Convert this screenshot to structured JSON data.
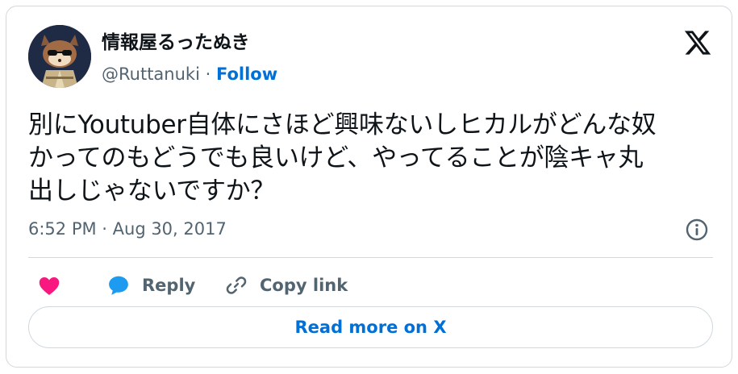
{
  "author": {
    "name": "情報屋るったぬき",
    "handle": "@Ruttanuki",
    "separator": " · ",
    "follow_label": "Follow",
    "avatar": "raccoon-detective-avatar"
  },
  "brand_icon": "x-logo-icon",
  "tweet": {
    "text": "別にYoutuber自体にさほど興味ないしヒカルがどんな奴\nかってのもどうでも良いけど、やってることが陰キャ丸\n出しじゃないですか？",
    "timestamp": "6:52 PM · Aug 30, 2017"
  },
  "actions": {
    "like_icon": "heart-icon",
    "reply_icon": "speech-bubble-icon",
    "reply_label": "Reply",
    "copy_icon": "link-icon",
    "copy_label": "Copy link"
  },
  "read_more_label": "Read more on X",
  "colors": {
    "link_blue": "#006fd6",
    "like_pink": "#f91880",
    "reply_blue": "#1d9bf0",
    "secondary_text": "#536471",
    "border": "#cfd9de"
  }
}
